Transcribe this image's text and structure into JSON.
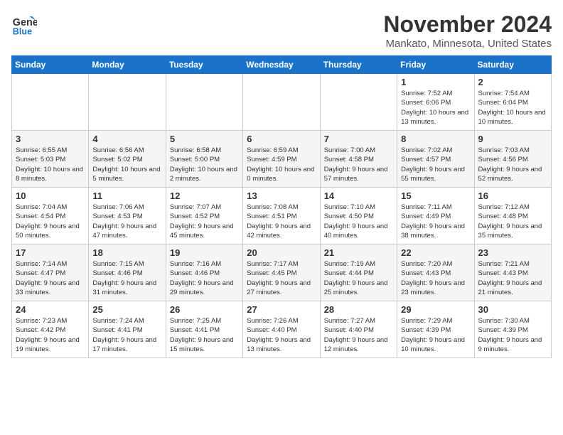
{
  "header": {
    "logo_line1": "General",
    "logo_line2": "Blue",
    "month": "November 2024",
    "location": "Mankato, Minnesota, United States"
  },
  "weekdays": [
    "Sunday",
    "Monday",
    "Tuesday",
    "Wednesday",
    "Thursday",
    "Friday",
    "Saturday"
  ],
  "weeks": [
    [
      {
        "day": "",
        "info": ""
      },
      {
        "day": "",
        "info": ""
      },
      {
        "day": "",
        "info": ""
      },
      {
        "day": "",
        "info": ""
      },
      {
        "day": "",
        "info": ""
      },
      {
        "day": "1",
        "info": "Sunrise: 7:52 AM\nSunset: 6:06 PM\nDaylight: 10 hours and 13 minutes."
      },
      {
        "day": "2",
        "info": "Sunrise: 7:54 AM\nSunset: 6:04 PM\nDaylight: 10 hours and 10 minutes."
      }
    ],
    [
      {
        "day": "3",
        "info": "Sunrise: 6:55 AM\nSunset: 5:03 PM\nDaylight: 10 hours and 8 minutes."
      },
      {
        "day": "4",
        "info": "Sunrise: 6:56 AM\nSunset: 5:02 PM\nDaylight: 10 hours and 5 minutes."
      },
      {
        "day": "5",
        "info": "Sunrise: 6:58 AM\nSunset: 5:00 PM\nDaylight: 10 hours and 2 minutes."
      },
      {
        "day": "6",
        "info": "Sunrise: 6:59 AM\nSunset: 4:59 PM\nDaylight: 10 hours and 0 minutes."
      },
      {
        "day": "7",
        "info": "Sunrise: 7:00 AM\nSunset: 4:58 PM\nDaylight: 9 hours and 57 minutes."
      },
      {
        "day": "8",
        "info": "Sunrise: 7:02 AM\nSunset: 4:57 PM\nDaylight: 9 hours and 55 minutes."
      },
      {
        "day": "9",
        "info": "Sunrise: 7:03 AM\nSunset: 4:56 PM\nDaylight: 9 hours and 52 minutes."
      }
    ],
    [
      {
        "day": "10",
        "info": "Sunrise: 7:04 AM\nSunset: 4:54 PM\nDaylight: 9 hours and 50 minutes."
      },
      {
        "day": "11",
        "info": "Sunrise: 7:06 AM\nSunset: 4:53 PM\nDaylight: 9 hours and 47 minutes."
      },
      {
        "day": "12",
        "info": "Sunrise: 7:07 AM\nSunset: 4:52 PM\nDaylight: 9 hours and 45 minutes."
      },
      {
        "day": "13",
        "info": "Sunrise: 7:08 AM\nSunset: 4:51 PM\nDaylight: 9 hours and 42 minutes."
      },
      {
        "day": "14",
        "info": "Sunrise: 7:10 AM\nSunset: 4:50 PM\nDaylight: 9 hours and 40 minutes."
      },
      {
        "day": "15",
        "info": "Sunrise: 7:11 AM\nSunset: 4:49 PM\nDaylight: 9 hours and 38 minutes."
      },
      {
        "day": "16",
        "info": "Sunrise: 7:12 AM\nSunset: 4:48 PM\nDaylight: 9 hours and 35 minutes."
      }
    ],
    [
      {
        "day": "17",
        "info": "Sunrise: 7:14 AM\nSunset: 4:47 PM\nDaylight: 9 hours and 33 minutes."
      },
      {
        "day": "18",
        "info": "Sunrise: 7:15 AM\nSunset: 4:46 PM\nDaylight: 9 hours and 31 minutes."
      },
      {
        "day": "19",
        "info": "Sunrise: 7:16 AM\nSunset: 4:46 PM\nDaylight: 9 hours and 29 minutes."
      },
      {
        "day": "20",
        "info": "Sunrise: 7:17 AM\nSunset: 4:45 PM\nDaylight: 9 hours and 27 minutes."
      },
      {
        "day": "21",
        "info": "Sunrise: 7:19 AM\nSunset: 4:44 PM\nDaylight: 9 hours and 25 minutes."
      },
      {
        "day": "22",
        "info": "Sunrise: 7:20 AM\nSunset: 4:43 PM\nDaylight: 9 hours and 23 minutes."
      },
      {
        "day": "23",
        "info": "Sunrise: 7:21 AM\nSunset: 4:43 PM\nDaylight: 9 hours and 21 minutes."
      }
    ],
    [
      {
        "day": "24",
        "info": "Sunrise: 7:23 AM\nSunset: 4:42 PM\nDaylight: 9 hours and 19 minutes."
      },
      {
        "day": "25",
        "info": "Sunrise: 7:24 AM\nSunset: 4:41 PM\nDaylight: 9 hours and 17 minutes."
      },
      {
        "day": "26",
        "info": "Sunrise: 7:25 AM\nSunset: 4:41 PM\nDaylight: 9 hours and 15 minutes."
      },
      {
        "day": "27",
        "info": "Sunrise: 7:26 AM\nSunset: 4:40 PM\nDaylight: 9 hours and 13 minutes."
      },
      {
        "day": "28",
        "info": "Sunrise: 7:27 AM\nSunset: 4:40 PM\nDaylight: 9 hours and 12 minutes."
      },
      {
        "day": "29",
        "info": "Sunrise: 7:29 AM\nSunset: 4:39 PM\nDaylight: 9 hours and 10 minutes."
      },
      {
        "day": "30",
        "info": "Sunrise: 7:30 AM\nSunset: 4:39 PM\nDaylight: 9 hours and 9 minutes."
      }
    ]
  ]
}
